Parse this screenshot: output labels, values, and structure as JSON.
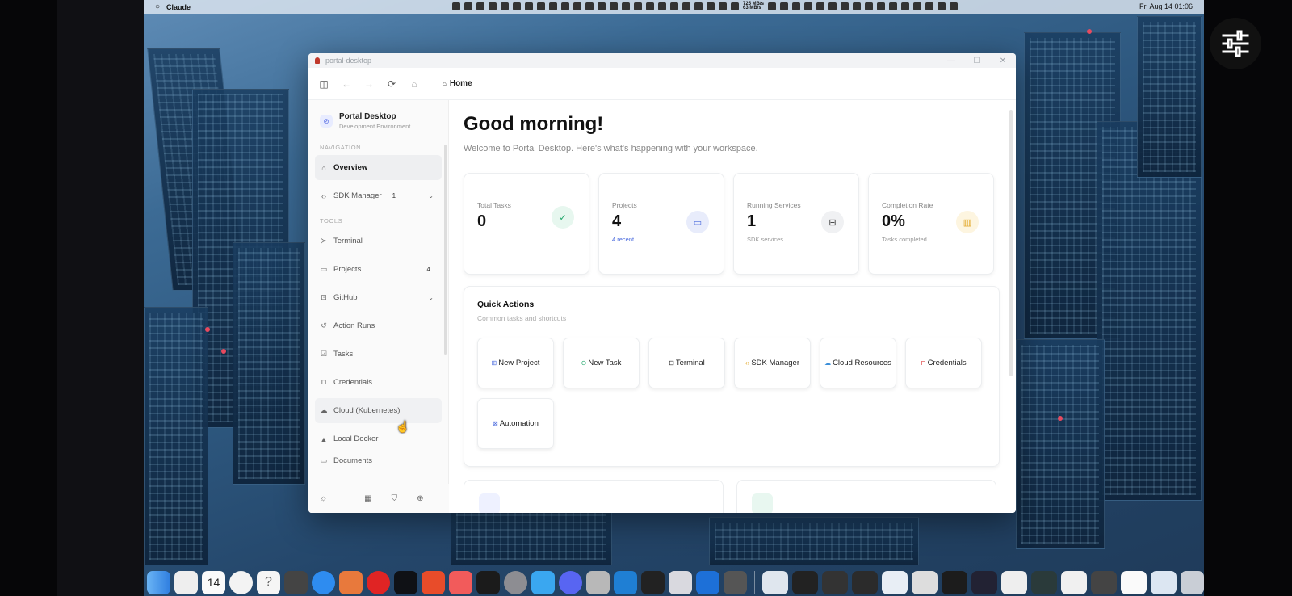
{
  "menubar": {
    "app_name": "Claude",
    "clock": "Fri Aug 14 01:06",
    "net_up": "725 MB/s",
    "net_down": "63 MB/s"
  },
  "window": {
    "title": "portal-desktop",
    "breadcrumb": "Home",
    "controls": [
      "—",
      "☐",
      "✕"
    ]
  },
  "sidebar": {
    "workspace": {
      "title": "Portal Desktop",
      "subtitle": "Development Environment"
    },
    "sections": [
      {
        "label": "NAVIGATION"
      },
      {
        "label": "TOOLS"
      }
    ],
    "nav": [
      {
        "label": "Overview",
        "icon": "home-icon"
      },
      {
        "label": "SDK Manager",
        "badge": "1",
        "icon": "code-icon"
      }
    ],
    "tools": [
      {
        "label": "Terminal",
        "icon": "terminal-icon"
      },
      {
        "label": "Projects",
        "badge": "4",
        "icon": "folder-icon"
      },
      {
        "label": "GitHub",
        "icon": "github-icon"
      },
      {
        "label": "Action Runs",
        "icon": "history-icon"
      },
      {
        "label": "Tasks",
        "icon": "checkbox-icon"
      },
      {
        "label": "Credentials",
        "icon": "lock-icon"
      },
      {
        "label": "Cloud (Kubernetes)",
        "icon": "cloud-icon"
      },
      {
        "label": "Local Docker",
        "icon": "docker-icon"
      },
      {
        "label": "Documents",
        "icon": "document-icon"
      }
    ]
  },
  "main": {
    "greeting": "Good morning!",
    "welcome": "Welcome to Portal Desktop. Here's what's happening with your workspace.",
    "stats": [
      {
        "label": "Total Tasks",
        "value": "0",
        "sub": "",
        "icon": "check-circle-icon",
        "color": "#1fa66a",
        "bg": "#e7f7ef"
      },
      {
        "label": "Projects",
        "value": "4",
        "sub": "4 recent",
        "icon": "folder-icon",
        "color": "#4b6bde",
        "bg": "#e8ecfb"
      },
      {
        "label": "Running Services",
        "value": "1",
        "sub": "SDK services",
        "icon": "server-icon",
        "color": "#333",
        "bg": "#f0f1f3"
      },
      {
        "label": "Completion Rate",
        "value": "0%",
        "sub": "Tasks completed",
        "icon": "bar-chart-icon",
        "color": "#e0a21b",
        "bg": "#fdf5e0"
      }
    ],
    "quick_actions": {
      "title": "Quick Actions",
      "subtitle": "Common tasks and shortcuts",
      "items": [
        {
          "label": "New Project",
          "icon": "new-project-icon",
          "color": "#4b6bde"
        },
        {
          "label": "New Task",
          "icon": "new-task-icon",
          "color": "#1fa66a"
        },
        {
          "label": "Terminal",
          "icon": "terminal-icon",
          "color": "#333"
        },
        {
          "label": "SDK Manager",
          "icon": "sdk-icon",
          "color": "#e0a21b"
        },
        {
          "label": "Cloud Resources",
          "icon": "cloud-icon",
          "color": "#3b8fd9"
        },
        {
          "label": "Credentials",
          "icon": "lock-icon",
          "color": "#e04848"
        },
        {
          "label": "Automation",
          "icon": "automation-icon",
          "color": "#4b6bde"
        }
      ]
    }
  }
}
